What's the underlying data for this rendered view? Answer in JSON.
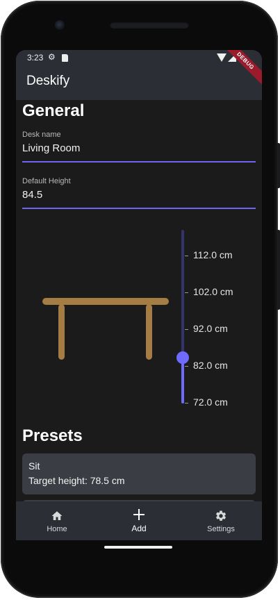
{
  "status_bar": {
    "time": "3:23"
  },
  "app_bar": {
    "title": "Deskify",
    "debug_banner": "DEBUG"
  },
  "general": {
    "title": "General",
    "desk_name": {
      "label": "Desk name",
      "value": "Living Room"
    },
    "default_height": {
      "label": "Default Height",
      "value": "84.5"
    }
  },
  "height_slider": {
    "ticks": [
      "112.0 cm",
      "102.0 cm",
      "92.0 cm",
      "82.0 cm",
      "72.0 cm"
    ],
    "min": 72.0,
    "max": 112.0,
    "value": 84.5,
    "active_color": "#6f6bff",
    "inactive_color": "#34346d"
  },
  "presets": {
    "title": "Presets",
    "items": [
      {
        "name": "Sit",
        "target": "Target height: 78.5 cm"
      }
    ]
  },
  "bottom_nav": {
    "items": [
      {
        "label": "Home",
        "icon": "home-icon"
      },
      {
        "label": "Add",
        "icon": "plus-icon"
      },
      {
        "label": "Settings",
        "icon": "gear-icon"
      }
    ]
  },
  "colors": {
    "desk": "#a67c45",
    "accent": "#6f6bff",
    "background": "#1b1b1c",
    "app_bar": "#2b2f35"
  }
}
